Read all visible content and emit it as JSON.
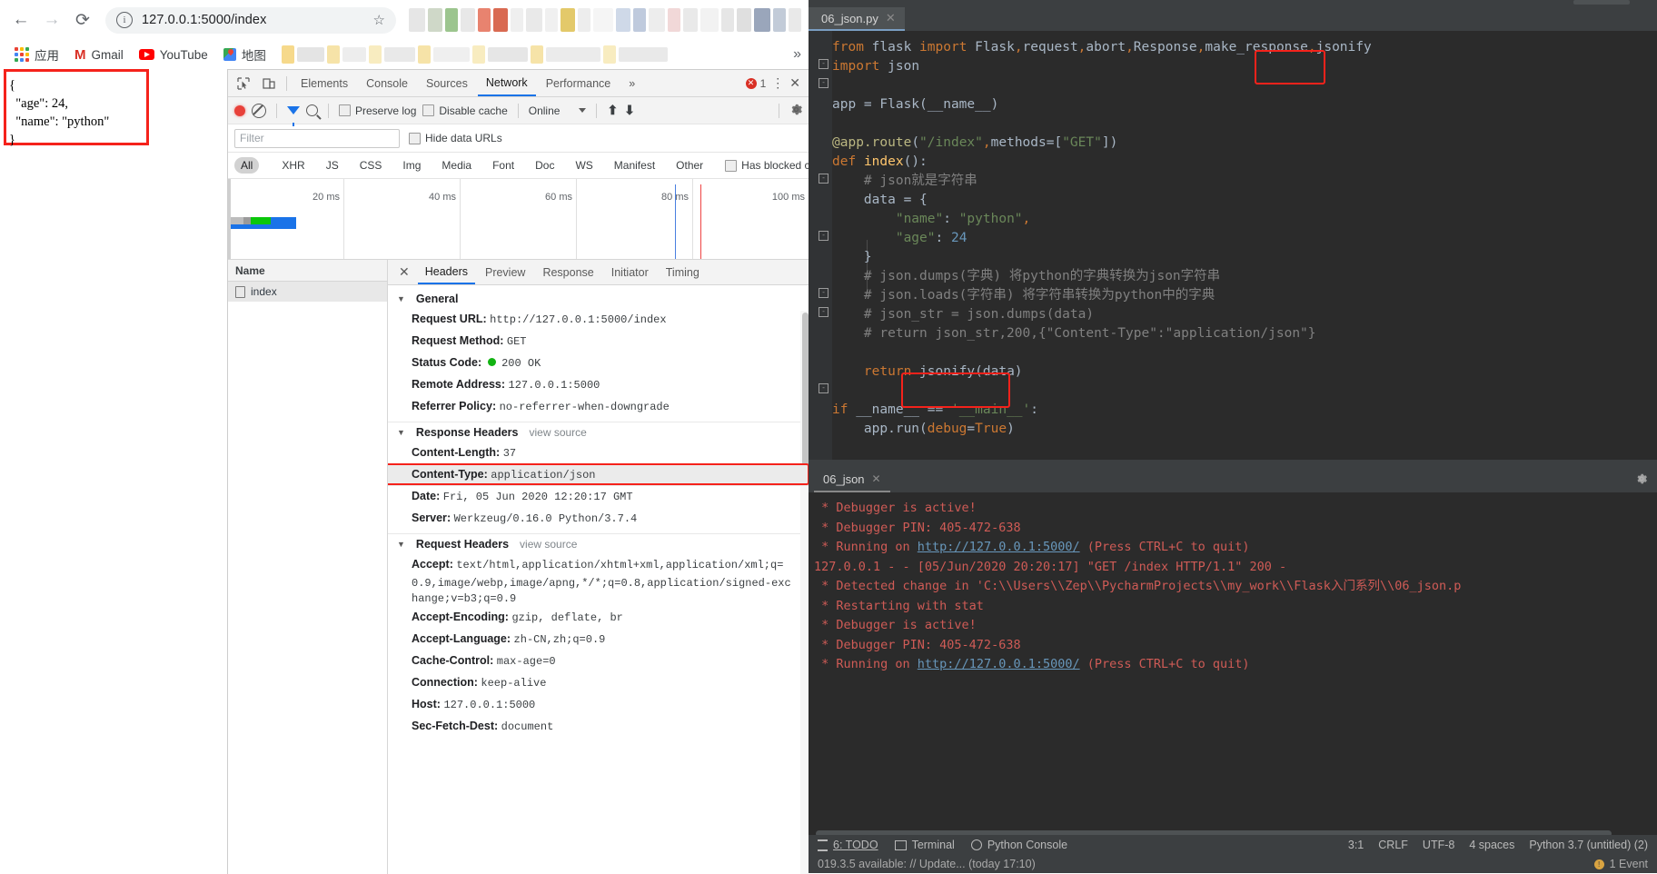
{
  "browser": {
    "nav": {
      "back": "←",
      "forward": "→",
      "reload": "⟳"
    },
    "omnibox": {
      "url": "127.0.0.1:5000/index",
      "info_icon": "ⓘ",
      "star": "☆"
    },
    "bookmarks": [
      {
        "label": "应用",
        "icon": "apps-grid-icon"
      },
      {
        "label": "Gmail",
        "icon": "gmail-icon"
      },
      {
        "label": "YouTube",
        "icon": "youtube-icon"
      },
      {
        "label": "地图",
        "icon": "maps-icon"
      }
    ],
    "bookmarks_overflow": "»",
    "page_json": "{\n  \"age\": 24,\n  \"name\": \"python\"\n}"
  },
  "devtools": {
    "tabs": [
      "Elements",
      "Console",
      "Sources",
      "Network",
      "Performance"
    ],
    "active_tab": "Network",
    "more_tabs": "»",
    "error_count": "1",
    "menu_icon": "⋮",
    "close_icon": "✕",
    "toolbar": {
      "record": "record-icon",
      "clear": "clear-icon",
      "filter": "filter-icon",
      "search": "search-icon",
      "preserve_log": "Preserve log",
      "disable_cache": "Disable cache",
      "throttling": "Online",
      "import_icon": "⬆",
      "export_icon": "⬇",
      "settings_icon": "gear-icon"
    },
    "filter": {
      "placeholder": "Filter",
      "value": "",
      "hide_data_urls": "Hide data URLs"
    },
    "types": [
      "All",
      "XHR",
      "JS",
      "CSS",
      "Img",
      "Media",
      "Font",
      "Doc",
      "WS",
      "Manifest",
      "Other"
    ],
    "active_type": "All",
    "has_blocked_cookies": "Has blocked cookies",
    "overview_ticks": [
      "20 ms",
      "40 ms",
      "60 ms",
      "80 ms",
      "100 ms"
    ],
    "request_list": {
      "header": "Name",
      "rows": [
        {
          "name": "index"
        }
      ]
    },
    "detail_tabs": [
      "Headers",
      "Preview",
      "Response",
      "Initiator",
      "Timing"
    ],
    "active_detail_tab": "Headers",
    "sections": [
      {
        "title": "General",
        "view_source": "",
        "rows": [
          {
            "key": "Request URL",
            "value": "http://127.0.0.1:5000/index"
          },
          {
            "key": "Request Method",
            "value": "GET"
          },
          {
            "key": "Status Code",
            "value": "200 OK",
            "status_dot": true
          },
          {
            "key": "Remote Address",
            "value": "127.0.0.1:5000"
          },
          {
            "key": "Referrer Policy",
            "value": "no-referrer-when-downgrade"
          }
        ]
      },
      {
        "title": "Response Headers",
        "view_source": "view source",
        "rows": [
          {
            "key": "Content-Length",
            "value": "37"
          },
          {
            "key": "Content-Type",
            "value": "application/json",
            "highlighted": true
          },
          {
            "key": "Date",
            "value": "Fri, 05 Jun 2020 12:20:17 GMT"
          },
          {
            "key": "Server",
            "value": "Werkzeug/0.16.0 Python/3.7.4"
          }
        ]
      },
      {
        "title": "Request Headers",
        "view_source": "view source",
        "rows": [
          {
            "key": "Accept",
            "value": "text/html,application/xhtml+xml,application/xml;q="
          },
          {
            "cont": "0.9,image/webp,image/apng,*/*;q=0.8,application/signed-exc"
          },
          {
            "cont": "hange;v=b3;q=0.9"
          },
          {
            "key": "Accept-Encoding",
            "value": "gzip, deflate, br"
          },
          {
            "key": "Accept-Language",
            "value": "zh-CN,zh;q=0.9"
          },
          {
            "key": "Cache-Control",
            "value": "max-age=0"
          },
          {
            "key": "Connection",
            "value": "keep-alive"
          },
          {
            "key": "Host",
            "value": "127.0.0.1:5000"
          },
          {
            "key": "Sec-Fetch-Dest",
            "value": "document"
          }
        ]
      }
    ]
  },
  "ide": {
    "editor_tab": {
      "label": "06_json.py",
      "close": "✕"
    },
    "code_lines": [
      "from flask import Flask,request,abort,Response,make_response,jsonify",
      "import json",
      "",
      "app = Flask(__name__)",
      "",
      "@app.route(\"/index\",methods=[\"GET\"])",
      "def index():",
      "    # json就是字符串",
      "    data = {",
      "        \"name\": \"python\",",
      "        \"age\": 24",
      "    }",
      "    # json.dumps(字典) 将python的字典转换为json字符串",
      "    # json.loads(字符串) 将字符串转换为python中的字典",
      "    # json_str = json.dumps(data)",
      "    # return json_str,200,{\"Content-Type\":\"application/json\"}",
      "",
      "    return jsonify(data)",
      "",
      "if __name__ == '__main__':",
      "    app.run(debug=True)"
    ],
    "highlight_jsonify_import": "jsonify",
    "highlight_return": "jsonify(data)",
    "run_tab": {
      "label": "06_json",
      "close": "✕"
    },
    "console_lines": [
      " * Debugger is active!",
      " * Debugger PIN: 405-472-638",
      " * Running on http://127.0.0.1:5000/ (Press CTRL+C to quit)",
      "127.0.0.1 - - [05/Jun/2020 20:20:17] \"GET /index HTTP/1.1\" 200 -",
      " * Detected change in 'C:\\\\Users\\\\Zep\\\\PycharmProjects\\\\my_work\\\\Flask入门系列\\\\06_json.p",
      " * Restarting with stat",
      " * Debugger is active!",
      " * Debugger PIN: 405-472-638",
      " * Running on http://127.0.0.1:5000/ (Press CTRL+C to quit)"
    ],
    "console_link": "http://127.0.0.1:5000/",
    "status_tools": [
      {
        "label": "6: TODO",
        "icon": "todo-icon"
      },
      {
        "label": "Terminal",
        "icon": "terminal-icon"
      },
      {
        "label": "Python Console",
        "icon": "python-console-icon"
      }
    ],
    "status_right": {
      "caret": "3:1",
      "line_sep": "CRLF",
      "encoding": "UTF-8",
      "indent": "4 spaces",
      "interpreter": "Python 3.7 (untitled) (2)"
    },
    "bottom_bar": {
      "notification": "019.3.5 available: // Update... (today 17:10)",
      "event_label": "1 Event"
    }
  }
}
